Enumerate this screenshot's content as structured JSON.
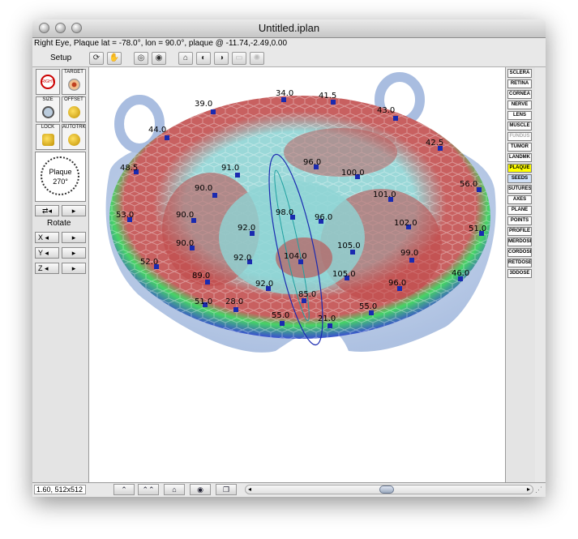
{
  "window": {
    "title": "Untitled.iplan"
  },
  "status": {
    "text": "Right Eye, Plaque lat = -78.0°, lon = 90.0°, plaque @ -11.74,-2.49,0.00"
  },
  "toolbar": {
    "setup_label": "Setup",
    "icons": [
      "orbit-view-icon",
      "hand-pan-icon",
      "zoom-out-icon",
      "zoom-in-icon",
      "home-view-icon",
      "eye-front-icon",
      "eye-side-icon",
      "layer-icon",
      "light-icon"
    ]
  },
  "left_panel": {
    "right_caption": "RIGHT",
    "target_caption": "TARGET",
    "size_caption": "SIZE",
    "offset_caption": "OFFSET",
    "lock_caption": "LOCK",
    "autotrk_caption": "AUTOTRK",
    "dial_label": "Plaque",
    "dial_value": "270°",
    "rotate_label": "Rotate",
    "axes": [
      "X",
      "Y",
      "Z"
    ]
  },
  "right_panel": {
    "items": [
      {
        "label": "SCLERA",
        "style": "normal"
      },
      {
        "label": "RETINA",
        "style": "normal"
      },
      {
        "label": "CORNEA",
        "style": "normal"
      },
      {
        "label": "NERVE",
        "style": "normal"
      },
      {
        "label": "LENS",
        "style": "normal"
      },
      {
        "label": "MUSCLE",
        "style": "normal"
      },
      {
        "label": "FUNDUS",
        "style": "dim"
      },
      {
        "label": "TUMOR",
        "style": "normal"
      },
      {
        "label": "LANDMK",
        "style": "normal"
      },
      {
        "label": "PLAQUE",
        "style": "yellow"
      },
      {
        "label": "SEEDS",
        "style": "blue"
      },
      {
        "label": "SUTURES",
        "style": "normal"
      },
      {
        "label": "AXES",
        "style": "normal"
      },
      {
        "label": "PLANE",
        "style": "normal"
      },
      {
        "label": "POINTS",
        "style": "normal"
      },
      {
        "label": "PROFILE",
        "style": "normal"
      },
      {
        "label": "MERDOSE",
        "style": "normal"
      },
      {
        "label": "CORDOSE",
        "style": "normal"
      },
      {
        "label": "RETDOSE",
        "style": "normal"
      },
      {
        "label": "3DDOSE",
        "style": "normal"
      }
    ]
  },
  "viewport": {
    "dose_labels": [
      "34.0",
      "41.5",
      "39.0",
      "43.0",
      "44.0",
      "42.5",
      "48.5",
      "56.0",
      "53.0",
      "51.0",
      "52.0",
      "46.0",
      "51.0",
      "28.0",
      "55.0",
      "55.0",
      "21.0",
      "85.0",
      "92.0",
      "92.0",
      "92.0",
      "91.0",
      "90.0",
      "90.0",
      "90.0",
      "89.0",
      "96.0",
      "100.0",
      "101.0",
      "102.0",
      "96.0",
      "105.0",
      "105.0",
      "99.0",
      "96.0",
      "98.0",
      "104.0"
    ],
    "colors": {
      "outer": "#b4c8e6",
      "blue": "#3c4fd2",
      "green": "#3fd65a",
      "red": "#c05050",
      "cyan": "#8fd4d4"
    }
  },
  "bottom": {
    "zoom_text": "1.60, 512x512",
    "icons": [
      "mountain-small-icon",
      "mountain-large-icon",
      "home-icon",
      "eye-icon",
      "copy-icon"
    ]
  }
}
